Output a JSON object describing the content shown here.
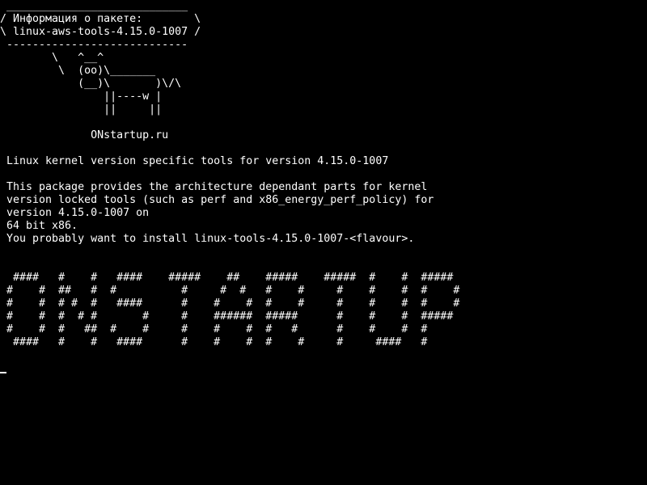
{
  "colors": {
    "background": "#000000",
    "text": "#ffffff"
  },
  "terminal": {
    "lines": [
      " ____________________________",
      "/ Информация о пакете:        \\",
      "\\ linux-aws-tools-4.15.0-1007 /",
      " ----------------------------",
      "        \\   ^__^",
      "         \\  (oo)\\_______",
      "            (__)\\       )\\/\\",
      "                ||----w |",
      "                ||     ||",
      "",
      "              ONstartup.ru",
      "",
      " Linux kernel version specific tools for version 4.15.0-1007",
      "",
      " This package provides the architecture dependant parts for kernel",
      " version locked tools (such as perf and x86_energy_perf_policy) for",
      " version 4.15.0-1007 on",
      " 64 bit x86.",
      " You probably want to install linux-tools-4.15.0-1007-<flavour>.",
      "",
      "",
      "  ####   #    #   ####    #####    ##    #####    #####  #    #  #####",
      " #    #  ##   #  #          #     #  #   #    #     #    #    #  #    #",
      " #    #  # #  #   ####      #    #    #  #    #     #    #    #  #    #",
      " #    #  #  # #       #     #    ######  #####      #    #    #  #####",
      " #    #  #   ##  #    #     #    #    #  #   #      #    #    #  #",
      "  ####   #    #   ####      #    #    #  #    #     #     ####   #"
    ]
  }
}
